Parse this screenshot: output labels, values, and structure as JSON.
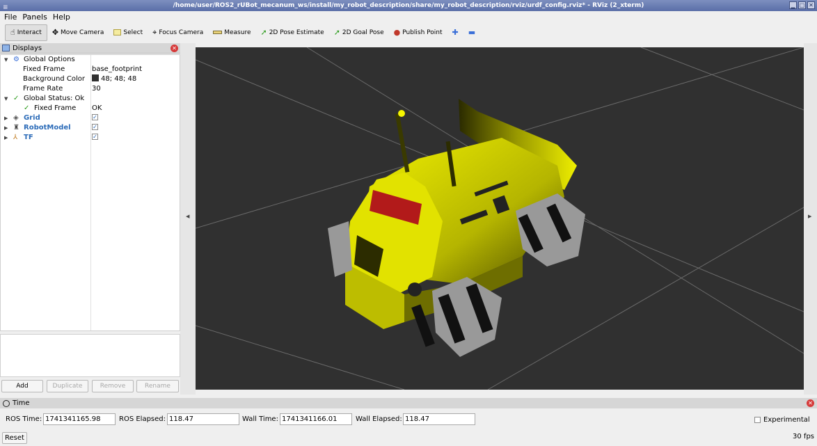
{
  "window": {
    "title": "/home/user/ROS2_rUBot_mecanum_ws/install/my_robot_description/share/my_robot_description/rviz/urdf_config.rviz* - RViz (2_xterm)"
  },
  "menu": [
    "File",
    "Panels",
    "Help"
  ],
  "toolbar": {
    "tools": [
      {
        "label": "Interact",
        "icon": "hand-icon"
      },
      {
        "label": "Move Camera",
        "icon": "move-camera-icon"
      },
      {
        "label": "Select",
        "icon": "select-icon"
      },
      {
        "label": "Focus Camera",
        "icon": "focus-camera-icon"
      },
      {
        "label": "Measure",
        "icon": "ruler-icon"
      },
      {
        "label": "2D Pose Estimate",
        "icon": "pose-arrow-icon"
      },
      {
        "label": "2D Goal Pose",
        "icon": "goal-arrow-icon"
      },
      {
        "label": "Publish Point",
        "icon": "pin-icon"
      }
    ]
  },
  "displays": {
    "title": "Displays",
    "global_options": {
      "label": "Global Options",
      "fixed_frame_label": "Fixed Frame",
      "fixed_frame_value": "base_footprint",
      "background_color_label": "Background Color",
      "background_color_value": "48; 48; 48",
      "frame_rate_label": "Frame Rate",
      "frame_rate_value": "30"
    },
    "global_status": {
      "label": "Global Status: Ok",
      "fixed_frame_label": "Fixed Frame",
      "fixed_frame_value": "OK"
    },
    "items": [
      {
        "label": "Grid",
        "checked": true
      },
      {
        "label": "RobotModel",
        "checked": true
      },
      {
        "label": "TF",
        "checked": true
      }
    ],
    "buttons": {
      "add": "Add",
      "duplicate": "Duplicate",
      "remove": "Remove",
      "rename": "Rename"
    }
  },
  "colors": {
    "viewport_bg": "#303030",
    "robot": "#e6e600"
  },
  "time": {
    "title": "Time",
    "ros_time_label": "ROS Time:",
    "ros_time": "1741341165.98",
    "ros_elapsed_label": "ROS Elapsed:",
    "ros_elapsed": "118.47",
    "wall_time_label": "Wall Time:",
    "wall_time": "1741341166.01",
    "wall_elapsed_label": "Wall Elapsed:",
    "wall_elapsed": "118.47",
    "experimental_label": "Experimental",
    "reset_label": "Reset",
    "fps": "30 fps"
  }
}
